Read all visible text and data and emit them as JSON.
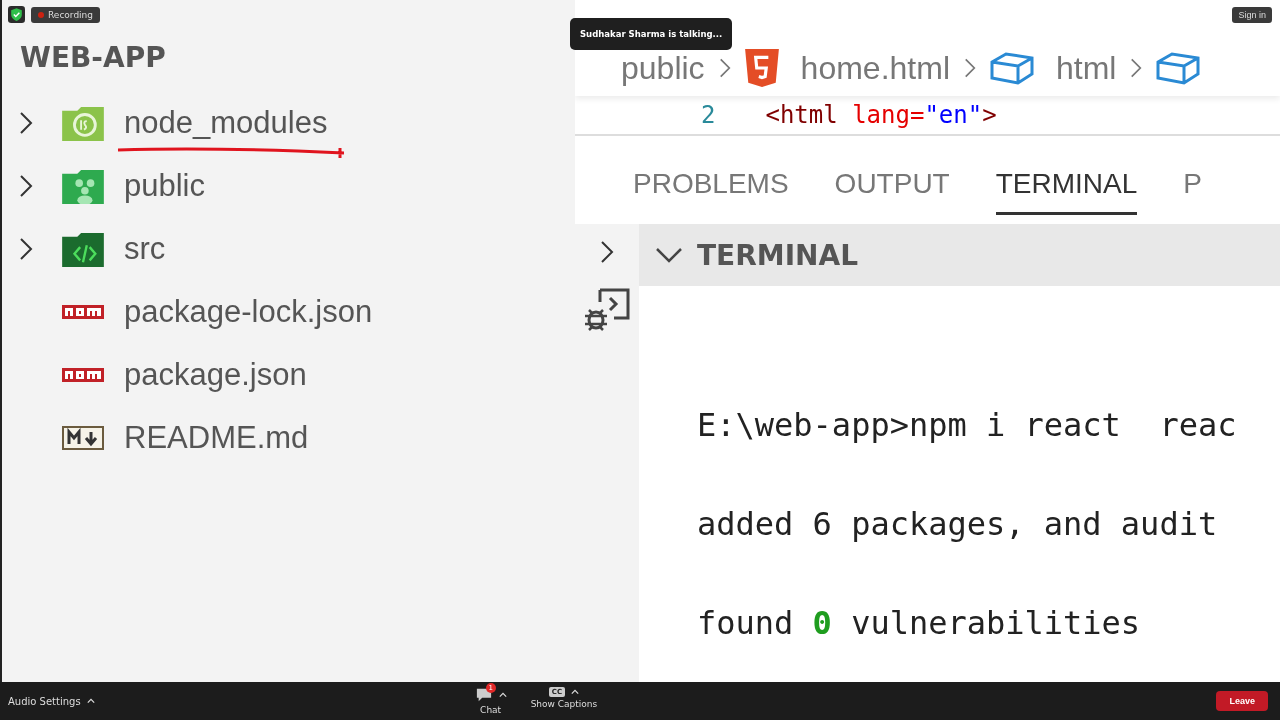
{
  "meeting": {
    "recording_label": "Recording",
    "talking_notice": "Sudhakar Sharma is talking...",
    "sign_in": "Sign in"
  },
  "explorer": {
    "title": "WEB-APP",
    "items": [
      {
        "name": "node_modules",
        "kind": "node",
        "expanded": false,
        "underlined": true
      },
      {
        "name": "public",
        "kind": "public",
        "expanded": false,
        "underlined": false
      },
      {
        "name": "src",
        "kind": "src",
        "expanded": false,
        "underlined": false
      },
      {
        "name": "package-lock.json",
        "kind": "npm",
        "underlined": false
      },
      {
        "name": "package.json",
        "kind": "npm",
        "underlined": false
      },
      {
        "name": "README.md",
        "kind": "markdown",
        "underlined": false
      }
    ]
  },
  "breadcrumb": [
    {
      "label": "public",
      "kind": "folder"
    },
    {
      "label": "home.html",
      "kind": "html"
    },
    {
      "label": "html",
      "kind": "element"
    },
    {
      "kind": "element"
    }
  ],
  "code_line": {
    "line_number": "2",
    "tag_open": "<html",
    "attr": "lang=",
    "value": "\"en\"",
    "tag_close": ">"
  },
  "panel_tabs": [
    {
      "label": "PROBLEMS",
      "selected": false
    },
    {
      "label": "OUTPUT",
      "selected": false
    },
    {
      "label": "TERMINAL",
      "selected": true
    },
    {
      "label": "P",
      "selected": false
    }
  ],
  "terminal": {
    "title": "TERMINAL",
    "expanded": true,
    "lines": [
      [
        {
          "text": "E:\\web-app>npm i react  reac"
        }
      ],
      [
        {
          "text": "added 6 packages, and audit"
        }
      ],
      [
        {
          "text": "found "
        },
        {
          "text": "0",
          "kind": "success"
        },
        {
          "text": " vulnerabilities"
        }
      ]
    ]
  },
  "meeting_bar": {
    "audio": "Audio Settings",
    "chat": "Chat",
    "chat_badge": "1",
    "captions_icon": "CC",
    "captions": "Show Captions",
    "leave": "Leave"
  }
}
